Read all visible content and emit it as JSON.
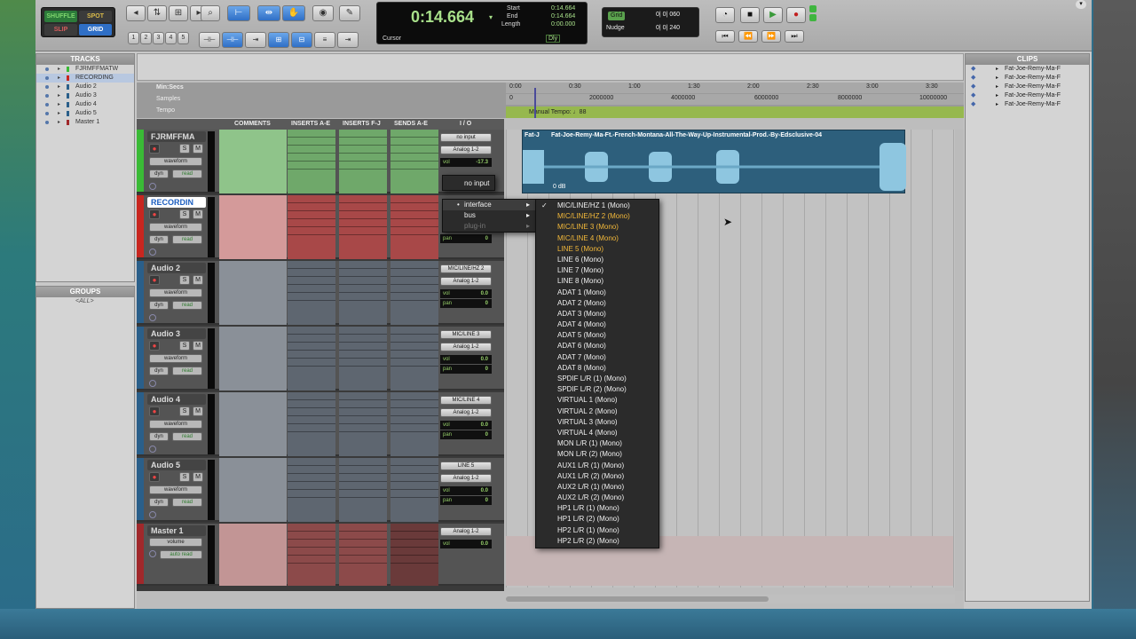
{
  "toolbar": {
    "modes": [
      "SHUFFLE",
      "SPOT",
      "SLIP",
      "GRID"
    ],
    "zoom_presets": [
      "1",
      "2",
      "3",
      "4",
      "5"
    ],
    "counter": {
      "main": "0:14.664",
      "start_label": "Start",
      "end_label": "End",
      "length_label": "Length",
      "start": "0:14.664",
      "end": "0:14.664",
      "length": "0:00.000",
      "cursor_label": "Cursor",
      "dly": "Dly"
    },
    "grid": {
      "label": "Grid",
      "value": "0| 0| 060"
    },
    "nudge": {
      "label": "Nudge",
      "value": "0| 0| 240"
    }
  },
  "tracks_panel": {
    "title": "TRACKS",
    "items": [
      "FJRMFFMATW",
      "RECORDING",
      "Audio 2",
      "Audio 3",
      "Audio 4",
      "Audio 5",
      "Master 1"
    ]
  },
  "groups_panel": {
    "title": "GROUPS",
    "items": [
      "<ALL>"
    ]
  },
  "rulers": {
    "min_secs": "Min:Secs",
    "samples": "Samples",
    "tempo": "Tempo",
    "time_ticks": [
      "0:00",
      "0:30",
      "1:00",
      "1:30",
      "2:00",
      "2:30",
      "3:00",
      "3:30"
    ],
    "sample_ticks": [
      "0",
      "2000000",
      "4000000",
      "6000000",
      "8000000",
      "10000000"
    ],
    "manual_tempo": "Manual Tempo: ♩88"
  },
  "columns": [
    "COMMENTS",
    "INSERTS A-E",
    "INSERTS F-J",
    "SENDS A-E",
    "I / O"
  ],
  "tracks": [
    {
      "name": "FJRMFFMA",
      "view": "waveform",
      "dyn": "dyn",
      "mode": "read",
      "input": "no input",
      "output": "Analog 1-2",
      "vol_label": "vol",
      "vol": "-17.3",
      "pan_label": "pan",
      "pan": "100",
      "color": "#3aba36"
    },
    {
      "name": "RECORDIN",
      "view": "waveform",
      "dyn": "dyn",
      "mode": "read",
      "input": "",
      "output": "",
      "vol_label": "vol",
      "vol": "0.0",
      "pan_label": "pan",
      "pan": "0",
      "color": "#c8261f"
    },
    {
      "name": "Audio 2",
      "view": "waveform",
      "dyn": "dyn",
      "mode": "read",
      "input": "MIC/LINE/HZ 2",
      "output": "Analog 1-2",
      "vol_label": "vol",
      "vol": "0.0",
      "pan_label": "pan",
      "pan": "0",
      "color": "#2a5f8a"
    },
    {
      "name": "Audio 3",
      "view": "waveform",
      "dyn": "dyn",
      "mode": "read",
      "input": "MIC/LINE 3",
      "output": "Analog 1-2",
      "vol_label": "vol",
      "vol": "0.0",
      "pan_label": "pan",
      "pan": "0",
      "color": "#2a5f8a"
    },
    {
      "name": "Audio 4",
      "view": "waveform",
      "dyn": "dyn",
      "mode": "read",
      "input": "MIC/LINE 4",
      "output": "Analog 1-2",
      "vol_label": "vol",
      "vol": "0.0",
      "pan_label": "pan",
      "pan": "0",
      "color": "#2a5f8a"
    },
    {
      "name": "Audio 5",
      "view": "waveform",
      "dyn": "dyn",
      "mode": "read",
      "input": "LINE 5",
      "output": "Analog 1-2",
      "vol_label": "vol",
      "vol": "0.0",
      "pan_label": "pan",
      "pan": "0",
      "color": "#2a5f8a"
    },
    {
      "name": "Master 1",
      "view": "volume",
      "dyn": "",
      "mode": "auto read",
      "input": "",
      "output": "Analog 1-2",
      "vol_label": "vol",
      "vol": "0.0",
      "pan_label": "",
      "pan": "",
      "color": "#a0282b"
    }
  ],
  "clip": {
    "name": "Fat-Joe-Remy-Ma-Ft.-French-Montana-All-The-Way-Up-Instrumental-Prod.-By-Edsclusive-04",
    "short": "Fat-J",
    "gain": "0 dB"
  },
  "input_menu": {
    "no_input": "no input",
    "interface": "interface",
    "bus": "bus",
    "plugin": "plug-in"
  },
  "interface_menu": {
    "items": [
      "MIC/LINE/HZ 1 (Mono)",
      "MIC/LINE/HZ 2 (Mono)",
      "MIC/LINE 3 (Mono)",
      "MIC/LINE 4 (Mono)",
      "LINE 5 (Mono)",
      "LINE 6 (Mono)",
      "LINE 7 (Mono)",
      "LINE 8 (Mono)",
      "ADAT 1 (Mono)",
      "ADAT 2 (Mono)",
      "ADAT 3 (Mono)",
      "ADAT 4 (Mono)",
      "ADAT 5 (Mono)",
      "ADAT 6 (Mono)",
      "ADAT 7 (Mono)",
      "ADAT 8 (Mono)",
      "SPDIF L/R (1) (Mono)",
      "SPDIF L/R (2) (Mono)",
      "VIRTUAL 1 (Mono)",
      "VIRTUAL 2 (Mono)",
      "VIRTUAL 3 (Mono)",
      "VIRTUAL 4 (Mono)",
      "MON L/R (1) (Mono)",
      "MON L/R (2) (Mono)",
      "AUX1 L/R (1) (Mono)",
      "AUX1 L/R (2) (Mono)",
      "AUX2 L/R (1) (Mono)",
      "AUX2 L/R (2) (Mono)",
      "HP1 L/R (1) (Mono)",
      "HP1 L/R (2) (Mono)",
      "HP2 L/R (1) (Mono)",
      "HP2 L/R (2) (Mono)"
    ],
    "checked_index": 0,
    "highlight_indices": [
      1,
      2,
      3,
      4
    ],
    "check_mark": "✓"
  },
  "clips_panel": {
    "title": "CLIPS",
    "items": [
      "Fat-Joe-Remy-Ma-F",
      "Fat-Joe-Remy-Ma-F",
      "Fat-Joe-Remy-Ma-F",
      "Fat-Joe-Remy-Ma-F",
      "Fat-Joe-Remy-Ma-F"
    ]
  },
  "colors": {
    "accent": "#f2b83a",
    "clip": "#2d5f7c",
    "waveform": "#8ec6e0",
    "counter_text": "#a8e08a"
  }
}
